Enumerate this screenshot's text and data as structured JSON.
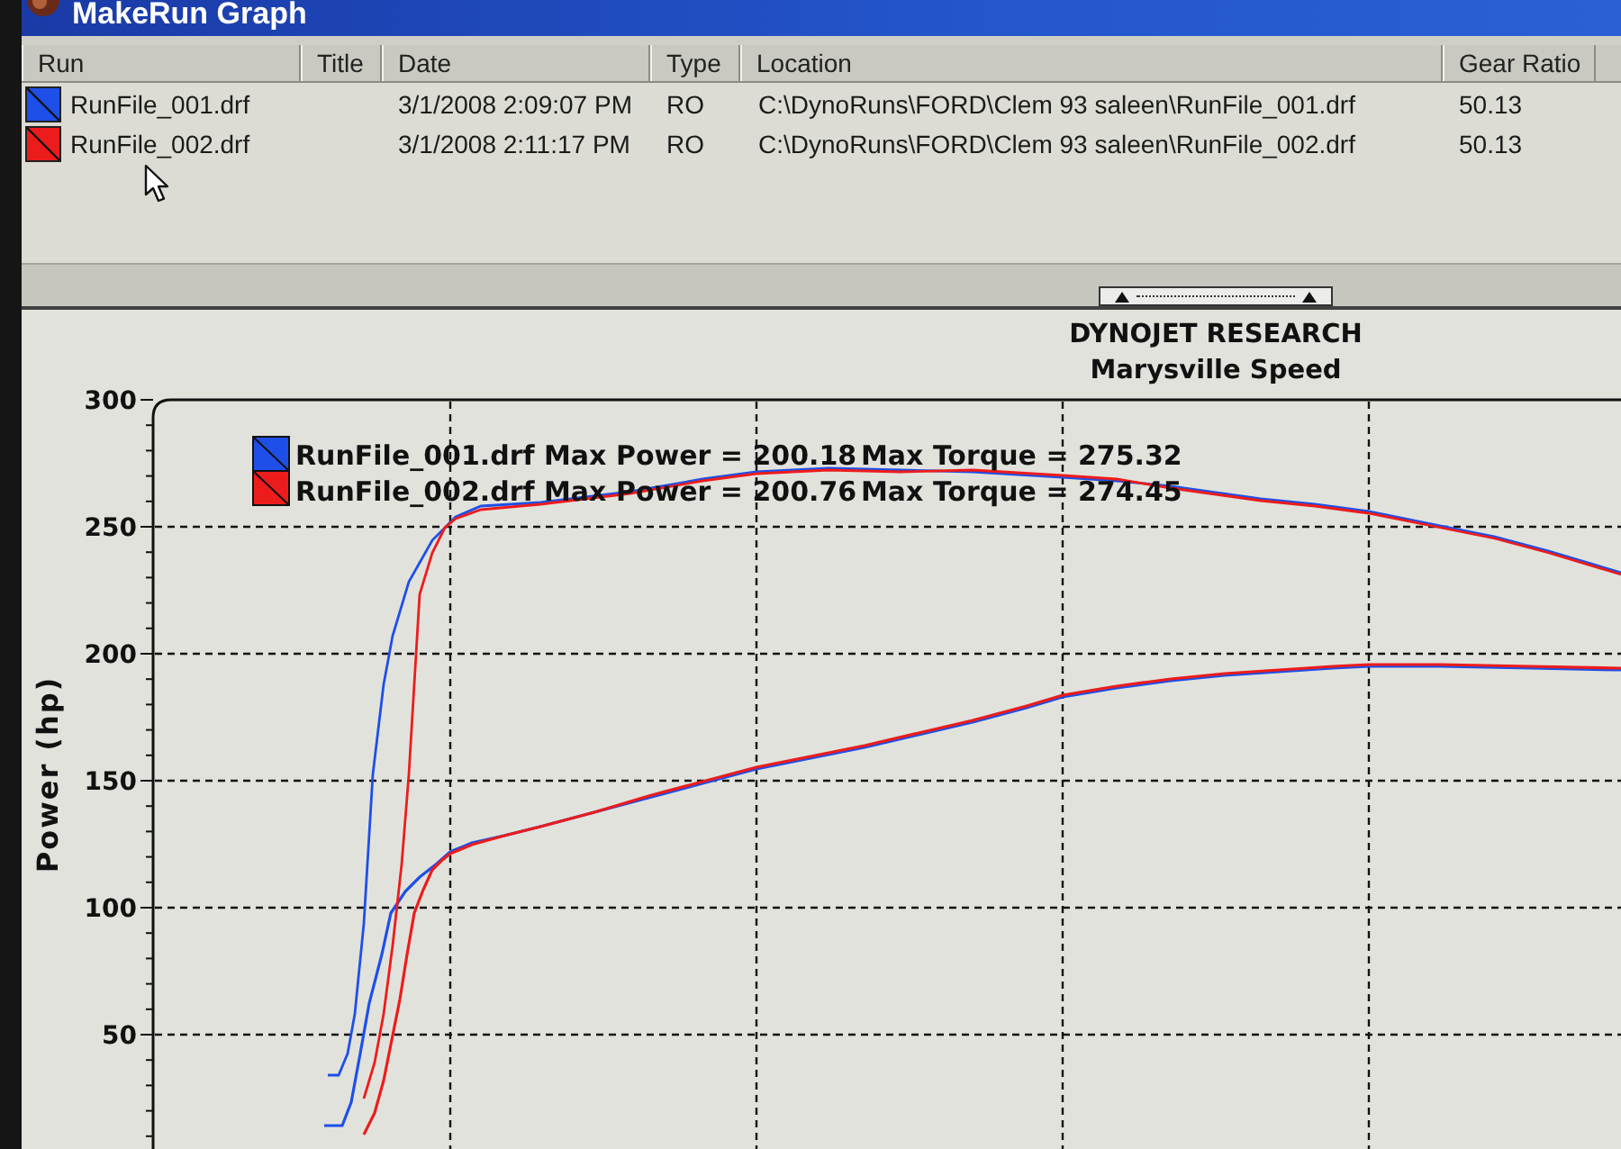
{
  "window": {
    "title": "MakeRun Graph"
  },
  "run_list": {
    "columns": [
      "Run",
      "Title",
      "Date",
      "Type",
      "Location",
      "Gear Ratio"
    ],
    "rows": [
      {
        "color": "#1e4fe8",
        "run": "RunFile_001.drf",
        "date": "3/1/2008 2:09:07 PM",
        "type": "RO",
        "location": "C:\\DynoRuns\\FORD\\Clem 93 saleen\\RunFile_001.drf",
        "gear_ratio": "50.13"
      },
      {
        "color": "#ec1c1c",
        "run": "RunFile_002.drf",
        "date": "3/1/2008 2:11:17 PM",
        "type": "RO",
        "location": "C:\\DynoRuns\\FORD\\Clem 93 saleen\\RunFile_002.drf",
        "gear_ratio": "50.13"
      }
    ]
  },
  "chart": {
    "title": "DYNOJET RESEARCH",
    "subtitle": "Marysville Speed",
    "y_axis_label": "Power (hp)",
    "y_ticks": [
      "300",
      "250",
      "200",
      "150",
      "100",
      "50"
    ],
    "legend": [
      {
        "color": "#1e4fe8",
        "label": "RunFile_001.drf Max Power = 200.18",
        "max_torque": "Max Torque = 275.32"
      },
      {
        "color": "#ec1c1c",
        "label": "RunFile_002.drf Max Power = 200.76",
        "max_torque": "Max Torque = 274.45"
      }
    ]
  }
}
